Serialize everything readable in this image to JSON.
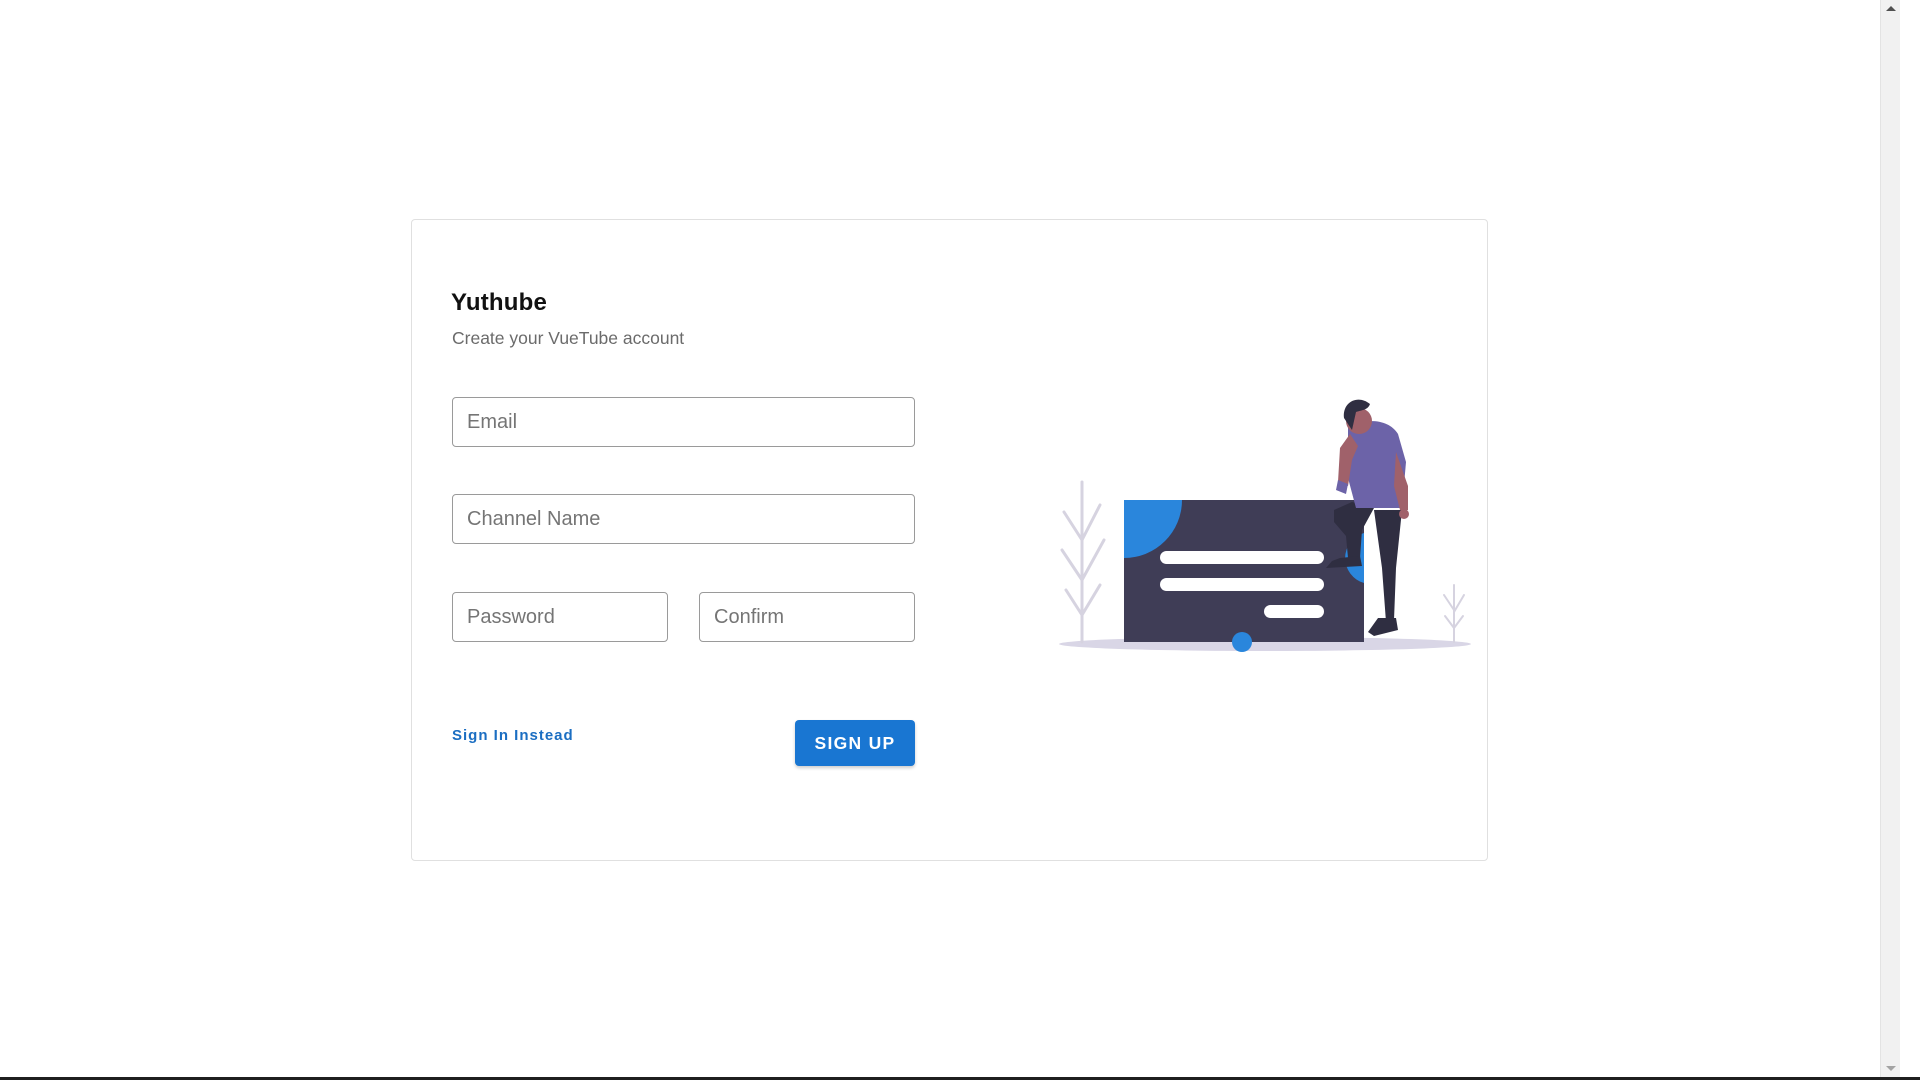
{
  "brand": {
    "title": "Yuthube"
  },
  "form": {
    "subtitle": "Create your VueTube account",
    "email_placeholder": "Email",
    "channel_placeholder": "Channel Name",
    "password_placeholder": "Password",
    "confirm_placeholder": "Confirm",
    "signin_label": "Sign In Instead",
    "signup_label": "SIGN UP"
  },
  "illustration": {
    "icon": "person-thinking-illustration"
  },
  "colors": {
    "accent": "#1976d2",
    "link": "#1b6ec2",
    "board": "#3f3d56",
    "blob": "#2a86dc",
    "shirt": "#6c63a8"
  }
}
